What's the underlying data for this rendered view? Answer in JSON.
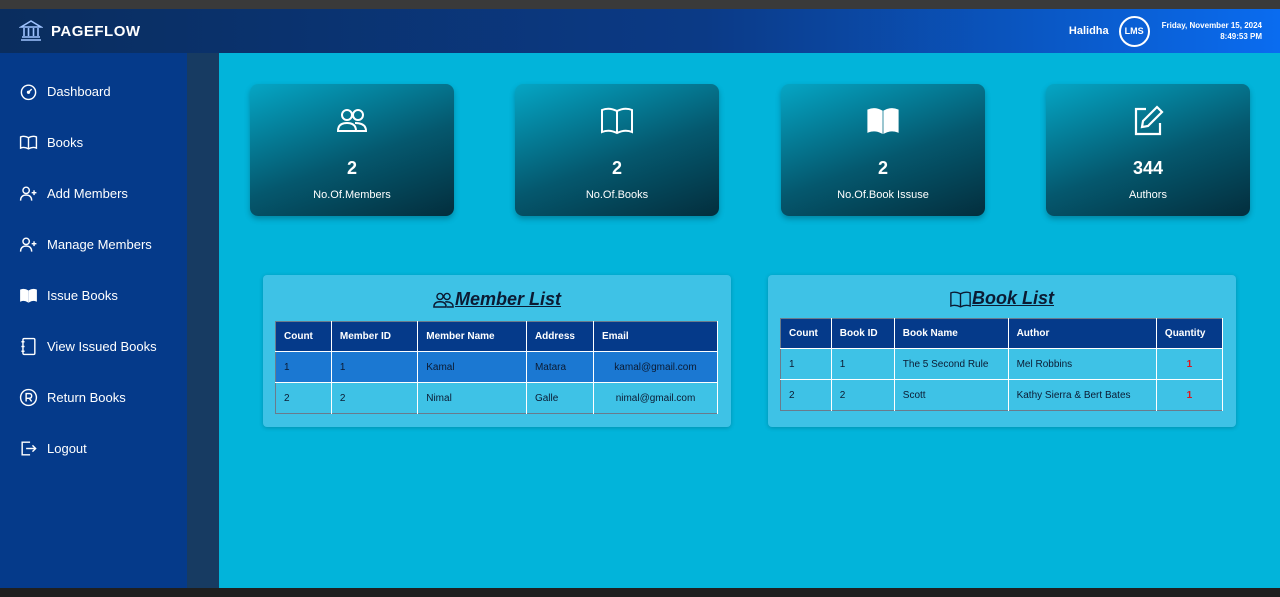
{
  "app": {
    "brand": "PAGEFLOW"
  },
  "user": {
    "name": "Halidha",
    "badge": "LMS",
    "date": "Friday, November 15, 2024",
    "time": "8:49:53 PM"
  },
  "sidebar": {
    "items": [
      {
        "label": "Dashboard",
        "icon": "dashboard-icon"
      },
      {
        "label": "Books",
        "icon": "book-icon"
      },
      {
        "label": "Add Members",
        "icon": "user-plus-icon"
      },
      {
        "label": "Manage Members",
        "icon": "user-plus-icon"
      },
      {
        "label": "Issue Books",
        "icon": "book-filled-icon"
      },
      {
        "label": "View Issued Books",
        "icon": "journal-icon"
      },
      {
        "label": "Return Books",
        "icon": "registered-icon"
      },
      {
        "label": "Logout",
        "icon": "logout-icon"
      }
    ]
  },
  "cards": [
    {
      "value": "2",
      "label": "No.Of.Members",
      "icon": "members-icon"
    },
    {
      "value": "2",
      "label": "No.Of.Books",
      "icon": "open-book-icon"
    },
    {
      "value": "2",
      "label": "No.Of.Book Issuse",
      "icon": "book-filled-icon"
    },
    {
      "value": "344",
      "label": "Authors",
      "icon": "edit-icon"
    }
  ],
  "member_list": {
    "title": "Member List",
    "columns": [
      "Count",
      "Member ID",
      "Member Name",
      "Address",
      "Email"
    ],
    "rows": [
      [
        "1",
        "1",
        "Kamal",
        "Matara",
        "kamal@gmail.com"
      ],
      [
        "2",
        "2",
        "Nimal",
        "Galle",
        "nimal@gmail.com"
      ]
    ]
  },
  "book_list": {
    "title": "Book List",
    "columns": [
      "Count",
      "Book ID",
      "Book Name",
      "Author",
      "Quantity"
    ],
    "rows": [
      [
        "1",
        "1",
        "The 5 Second Rule",
        "Mel Robbins",
        "1"
      ],
      [
        "2",
        "2",
        "Scott",
        "Kathy Sierra & Bert Bates",
        "1"
      ]
    ]
  },
  "colors": {
    "header_start": "#0a2d5e",
    "header_end": "#0a6cf0",
    "sidebar": "#053a8a",
    "main": "#02b4da",
    "quantity": "#e0141e"
  }
}
